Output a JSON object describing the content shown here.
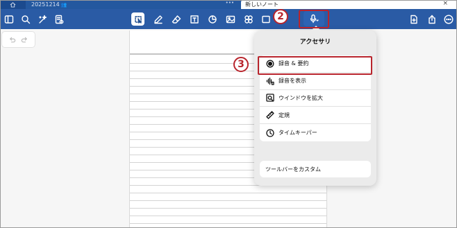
{
  "tabs": {
    "home_icon": "home-icon",
    "document_title": "20251214",
    "document_dots": "•••",
    "active_title": "新しいノート",
    "active_close": "×"
  },
  "toolbar": {
    "left_icons": [
      "sidebar-icon",
      "search-icon",
      "magic-wand-icon",
      "note-list-icon"
    ],
    "tool_icons": [
      "lasso-icon",
      "pen-icon",
      "eraser-icon",
      "textbox-icon",
      "shape-icon",
      "image-icon",
      "elements-icon",
      "screen-icon"
    ],
    "mic_icon": "mic-icon",
    "right_icons": [
      "add-page-icon",
      "share-icon",
      "more-icon"
    ]
  },
  "popover": {
    "title": "アクセサリ",
    "items": [
      {
        "label": "録音 & 要約",
        "icon": "record-dot-icon"
      },
      {
        "label": "録音を表示",
        "icon": "waveform-icon"
      },
      {
        "label": "ウインドウを拡大",
        "icon": "zoom-window-icon"
      },
      {
        "label": "定規",
        "icon": "ruler-icon"
      },
      {
        "label": "タイムキーパー",
        "icon": "clock-icon"
      }
    ],
    "customize_label": "ツールバーをカスタム"
  },
  "callouts": {
    "step2": "2",
    "step3": "3"
  },
  "colors": {
    "toolbar_bg": "#2a5ba5",
    "tabbar_bg": "#1b4a8e",
    "callout": "#b8242c"
  }
}
